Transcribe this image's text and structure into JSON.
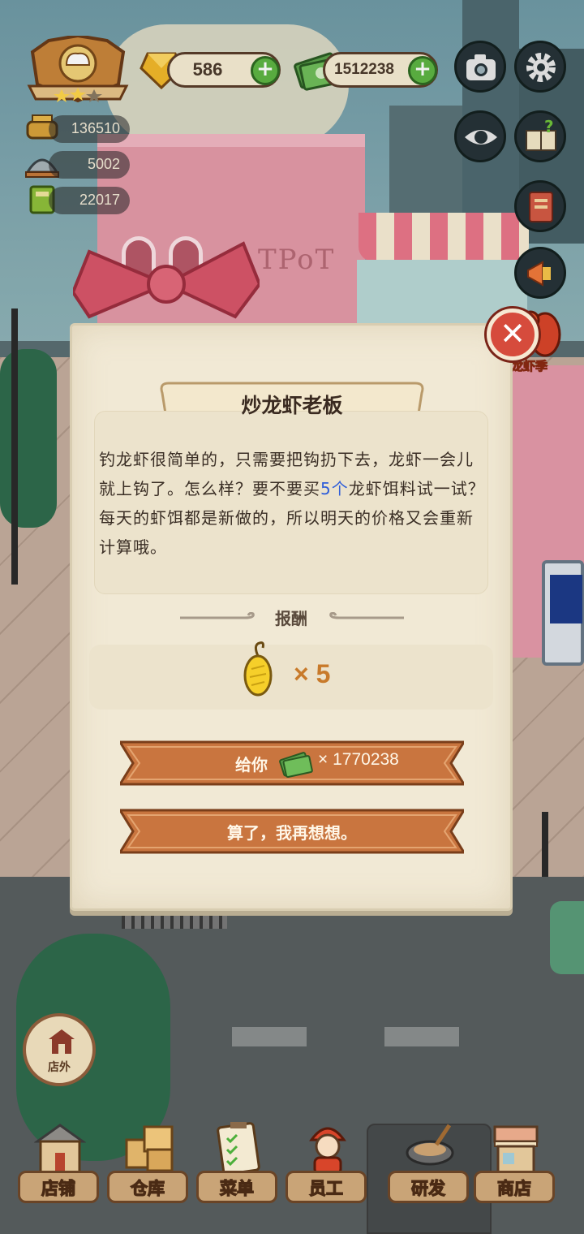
{
  "hud": {
    "gems": "586",
    "cash": "1512238",
    "stats": [
      {
        "icon": "hotpot-icon",
        "value": "136510"
      },
      {
        "icon": "dish-cover-icon",
        "value": "5002"
      },
      {
        "icon": "recipe-book-icon",
        "value": "22017"
      }
    ]
  },
  "event": {
    "label": "龙虾季"
  },
  "dialog": {
    "title": "炒龙虾老板",
    "body_parts": [
      "钓龙虾很简单的，只需要把钩扔下去，龙虾一会儿就上钩了。怎么样？要不要买",
      "5个",
      "龙虾饵料试一试？",
      "每天的虾饵都是新做的，所以明天的价格又会重新计算哦。"
    ],
    "highlight_color": "#2f5ed9",
    "reward_title": "报酬",
    "reward_item": "bait-icon",
    "reward_qty": "× 5",
    "buy_label": "给你",
    "buy_amount": "× 1770238",
    "cancel_label": "算了，我再想想。",
    "close_icon": "close-icon"
  },
  "outside_button": "店外",
  "nav": [
    {
      "label": "店铺",
      "icon": "shop-icon"
    },
    {
      "label": "仓库",
      "icon": "warehouse-icon"
    },
    {
      "label": "菜单",
      "icon": "menu-clipboard-icon"
    },
    {
      "label": "员工",
      "icon": "staff-icon"
    },
    {
      "label": "研发",
      "icon": "research-wok-icon"
    },
    {
      "label": "商店",
      "icon": "store-icon"
    }
  ],
  "colors": {
    "accent_red": "#d64b3c",
    "ribbon": "#c9753f",
    "plus_green": "#5db543"
  }
}
